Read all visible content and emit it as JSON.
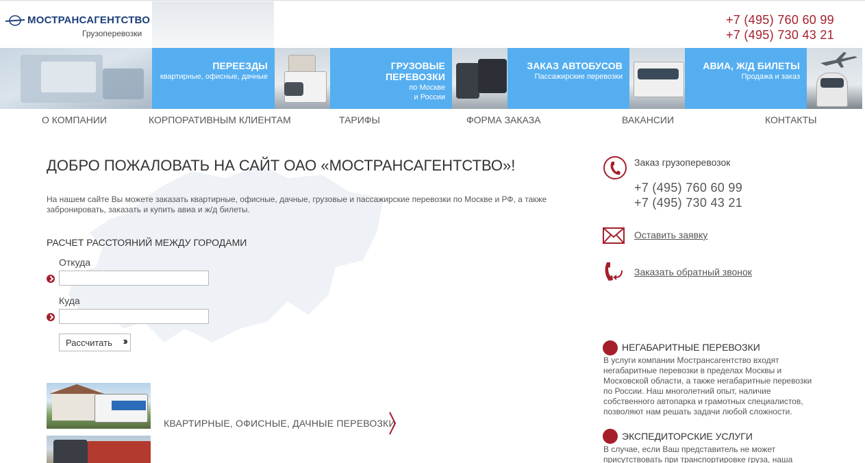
{
  "header": {
    "logo_title": "МОСТРАНСАГЕНТСТВО",
    "logo_subtitle": "Грузоперевозки",
    "phones": [
      "+7 (495) 760 60 99",
      "+7 (495) 730 43 21"
    ]
  },
  "banner": [
    {
      "title": "ПЕРЕЕЗДЫ",
      "subtitle": "квартирные, офисные, дачные"
    },
    {
      "title": "ГРУЗОВЫЕ ПЕРЕВОЗКИ",
      "subtitle_line1": "по Москве",
      "subtitle_line2": "и России"
    },
    {
      "title": "ЗАКАЗ АВТОБУСОВ",
      "subtitle": "Пассажирские перевозки"
    },
    {
      "title": "АВИА, Ж/Д БИЛЕТЫ",
      "subtitle": "Продажа и заказ"
    }
  ],
  "nav": [
    "О КОМПАНИИ",
    "КОРПОРАТИВНЫМ КЛИЕНТАМ",
    "ТАРИФЫ",
    "ФОРМА ЗАКАЗА",
    "ВАКАНСИИ",
    "КОНТАКТЫ"
  ],
  "main": {
    "welcome": "ДОБРО ПОЖАЛОВАТЬ НА САЙТ ОАО «МОСТРАНСАГЕНТСТВО»!",
    "intro": "На нашем сайте Вы можете заказать квартирные, офисные, дачные, грузовые и пассажирские перевозки по Москве и РФ, а также забронировать, заказать и купить авиа и ж/д билеты.",
    "calc_title": "РАСЧЕТ РАССТОЯНИЙ МЕЖДУ ГОРОДАМИ",
    "from_label": "Откуда",
    "from_value": "",
    "to_label": "Куда",
    "to_value": "",
    "calc_button": "Рассчитать",
    "service_link": "КВАРТИРНЫЕ, ОФИСНЫЕ, ДАЧНЫЕ ПЕРЕВОЗКИ"
  },
  "right": {
    "order_title": "Заказ грузоперевозок",
    "phones": [
      "+7 (495) 760 60 99",
      "+7 (495) 730 43 21"
    ],
    "request_link": "Оставить заявку",
    "callback_link": "Заказать обратный звонок",
    "sections": [
      {
        "title": "НЕГАБАРИТНЫЕ ПЕРЕВОЗКИ",
        "text": "В услуги компании Мострансагентство входят негабаритные перевозки в пределах Москвы и Московской области, а также негабаритные перевозки по России. Наш многолетний опыт, наличие собственного автопарка и грамотных специалистов, позволяют нам решать задачи любой сложности."
      },
      {
        "title": "ЭКСПЕДИТОРСКИЕ УСЛУГИ",
        "text": "В случае, если Ваш представитель не может присутствовать при транспортировке груза, наша"
      }
    ]
  },
  "colors": {
    "accent_red": "#a51f2b",
    "banner_blue": "#55aef0",
    "logo_blue": "#1d3f7a"
  }
}
